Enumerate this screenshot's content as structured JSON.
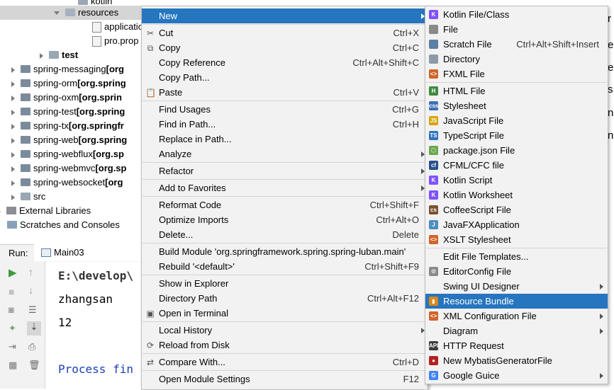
{
  "tree": {
    "items": [
      {
        "label": "kotlin",
        "indent": 110,
        "type": "folder",
        "arrow": "none"
      },
      {
        "label": "resources",
        "indent": 90,
        "type": "res",
        "arrow": "down"
      },
      {
        "label": "applicatio",
        "indent": 130,
        "type": "file",
        "arrow": "none"
      },
      {
        "label": "pro.prop",
        "indent": 130,
        "type": "file",
        "arrow": "none"
      },
      {
        "label": "test",
        "indent": 70,
        "type": "folder",
        "arrow": "right",
        "bold": true
      },
      {
        "label": "spring-messaging",
        "suffix": "[org",
        "indent": 30,
        "type": "mod",
        "arrow": "right"
      },
      {
        "label": "spring-orm",
        "suffix": "[org.spring",
        "indent": 30,
        "type": "mod",
        "arrow": "right"
      },
      {
        "label": "spring-oxm",
        "suffix": "[org.sprin",
        "indent": 30,
        "type": "mod",
        "arrow": "right"
      },
      {
        "label": "spring-test",
        "suffix": "[org.spring",
        "indent": 30,
        "type": "mod",
        "arrow": "right"
      },
      {
        "label": "spring-tx",
        "suffix": "[org.springfr",
        "indent": 30,
        "type": "mod",
        "arrow": "right"
      },
      {
        "label": "spring-web",
        "suffix": "[org.spring",
        "indent": 30,
        "type": "mod",
        "arrow": "right"
      },
      {
        "label": "spring-webflux",
        "suffix": "[org.sp",
        "indent": 30,
        "type": "mod",
        "arrow": "right"
      },
      {
        "label": "spring-webmvc",
        "suffix": "[org.sp",
        "indent": 30,
        "type": "mod",
        "arrow": "right"
      },
      {
        "label": "spring-websocket",
        "suffix": "[org",
        "indent": 30,
        "type": "mod",
        "arrow": "right"
      },
      {
        "label": "src",
        "indent": 30,
        "type": "folder",
        "arrow": "right"
      },
      {
        "label": "External Libraries",
        "indent": 10,
        "type": "lib",
        "arrow": "right"
      },
      {
        "label": "Scratches and Consoles",
        "indent": 10,
        "type": "scratch",
        "arrow": "none"
      }
    ]
  },
  "run": {
    "label": "Run:",
    "tab": "Main03",
    "console_lines": [
      "E:\\develop\\",
      "zhangsan",
      "12",
      "",
      "Process fin"
    ]
  },
  "editor_chars": [
    "r",
    "e",
    "e",
    "s",
    "n",
    "n"
  ],
  "menu": {
    "items": [
      {
        "label": "New",
        "shortcut": "",
        "sub": true,
        "sel": true,
        "u": ""
      },
      {
        "sep": true
      },
      {
        "label": "Cut",
        "shortcut": "Ctrl+X",
        "icon": "✂",
        "icon_name": "cut-icon"
      },
      {
        "label": "Copy",
        "shortcut": "Ctrl+C",
        "icon": "⧉",
        "icon_name": "copy-icon"
      },
      {
        "label": "Copy Reference",
        "shortcut": "Ctrl+Alt+Shift+C"
      },
      {
        "label": "Copy Path...",
        "shortcut": ""
      },
      {
        "label": "Paste",
        "shortcut": "Ctrl+V",
        "icon": "📋",
        "icon_name": "paste-icon"
      },
      {
        "sep": true
      },
      {
        "label": "Find Usages",
        "shortcut": "Ctrl+G"
      },
      {
        "label": "Find in Path...",
        "shortcut": "Ctrl+H"
      },
      {
        "label": "Replace in Path...",
        "shortcut": ""
      },
      {
        "label": "Analyze",
        "shortcut": "",
        "sub": true
      },
      {
        "sep": true
      },
      {
        "label": "Refactor",
        "shortcut": "",
        "sub": true
      },
      {
        "sep": true
      },
      {
        "label": "Add to Favorites",
        "shortcut": "",
        "sub": true
      },
      {
        "sep": true
      },
      {
        "label": "Reformat Code",
        "shortcut": "Ctrl+Shift+F"
      },
      {
        "label": "Optimize Imports",
        "shortcut": "Ctrl+Alt+O"
      },
      {
        "label": "Delete...",
        "shortcut": "Delete"
      },
      {
        "sep": true
      },
      {
        "label": "Build Module 'org.springframework.spring.spring-luban.main'",
        "shortcut": ""
      },
      {
        "label": "Rebuild '<default>'",
        "shortcut": "Ctrl+Shift+F9"
      },
      {
        "sep": true
      },
      {
        "label": "Show in Explorer",
        "shortcut": ""
      },
      {
        "label": "Directory Path",
        "shortcut": "Ctrl+Alt+F12"
      },
      {
        "label": "Open in Terminal",
        "shortcut": "",
        "icon": "▣",
        "icon_name": "terminal-icon"
      },
      {
        "sep": true
      },
      {
        "label": "Local History",
        "shortcut": "",
        "sub": true
      },
      {
        "label": "Reload from Disk",
        "shortcut": "",
        "icon": "⟳",
        "icon_name": "reload-icon"
      },
      {
        "sep": true
      },
      {
        "label": "Compare With...",
        "shortcut": "Ctrl+D",
        "icon": "⇄",
        "icon_name": "compare-icon"
      },
      {
        "sep": true
      },
      {
        "label": "Open Module Settings",
        "shortcut": "F12"
      }
    ]
  },
  "submenu": {
    "items": [
      {
        "label": "Kotlin File/Class",
        "color": "#7f52ff",
        "glyph": "K",
        "icon_name": "kotlin-file-icon"
      },
      {
        "label": "File",
        "color": "#8a8a8a",
        "glyph": "",
        "icon_name": "file-icon"
      },
      {
        "label": "Scratch File",
        "shortcut": "Ctrl+Alt+Shift+Insert",
        "color": "#5c7fa6",
        "glyph": "",
        "icon_name": "scratch-file-icon"
      },
      {
        "label": "Directory",
        "color": "#8d9aa8",
        "glyph": "",
        "icon_name": "directory-icon"
      },
      {
        "label": "FXML File",
        "color": "#d0652b",
        "glyph": "<>",
        "icon_name": "fxml-file-icon"
      },
      {
        "sep": true
      },
      {
        "label": "HTML File",
        "color": "#3f8a3f",
        "glyph": "H",
        "icon_name": "html-file-icon"
      },
      {
        "label": "Stylesheet",
        "color": "#3f6fb5",
        "glyph": "css",
        "icon_name": "stylesheet-icon"
      },
      {
        "label": "JavaScript File",
        "color": "#d6a50c",
        "glyph": "JS",
        "icon_name": "javascript-file-icon"
      },
      {
        "label": "TypeScript File",
        "color": "#2f74c0",
        "glyph": "TS",
        "icon_name": "typescript-file-icon"
      },
      {
        "label": "package.json File",
        "color": "#6aa84f",
        "glyph": "⬡",
        "icon_name": "package-json-icon"
      },
      {
        "label": "CFML/CFC file",
        "color": "#274f8c",
        "glyph": "cf",
        "icon_name": "cfml-file-icon"
      },
      {
        "label": "Kotlin Script",
        "color": "#7f52ff",
        "glyph": "K",
        "icon_name": "kotlin-script-icon"
      },
      {
        "label": "Kotlin Worksheet",
        "color": "#7f52ff",
        "glyph": "K",
        "icon_name": "kotlin-worksheet-icon"
      },
      {
        "label": "CoffeeScript File",
        "color": "#7a5230",
        "glyph": "cs",
        "icon_name": "coffeescript-file-icon"
      },
      {
        "label": "JavaFXApplication",
        "color": "#4a8fbf",
        "glyph": "J",
        "icon_name": "javafx-icon"
      },
      {
        "label": "XSLT Stylesheet",
        "color": "#d0652b",
        "glyph": "<>",
        "icon_name": "xslt-icon"
      },
      {
        "sep": true
      },
      {
        "label": "Edit File Templates...",
        "color": "",
        "glyph": "",
        "icon_name": ""
      },
      {
        "label": "EditorConfig File",
        "color": "#8a8a8a",
        "glyph": "⚙",
        "icon_name": "editorconfig-icon"
      },
      {
        "label": "Swing UI Designer",
        "sub": true,
        "color": "",
        "glyph": "",
        "icon_name": ""
      },
      {
        "label": "Resource Bundle",
        "sel": true,
        "color": "#d88a1b",
        "glyph": "▮",
        "icon_name": "resource-bundle-icon"
      },
      {
        "label": "XML Configuration File",
        "sub": true,
        "color": "#d0652b",
        "glyph": "<>",
        "icon_name": "xml-config-icon"
      },
      {
        "label": "Diagram",
        "sub": true,
        "color": "",
        "glyph": "",
        "icon_name": ""
      },
      {
        "label": "HTTP Request",
        "color": "#3c3c3c",
        "glyph": "API",
        "icon_name": "http-request-icon"
      },
      {
        "label": "New MybatisGeneratorFile",
        "color": "#b22222",
        "glyph": "●",
        "icon_name": "mybatis-icon"
      },
      {
        "label": "Google Guice",
        "sub": true,
        "color": "#4285f4",
        "glyph": "G",
        "icon_name": "google-guice-icon"
      }
    ]
  }
}
